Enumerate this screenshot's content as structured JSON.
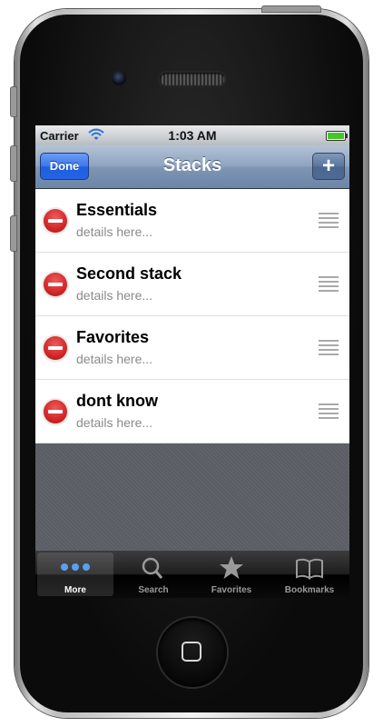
{
  "status_bar": {
    "carrier": "Carrier",
    "time": "1:03 AM"
  },
  "nav": {
    "title": "Stacks",
    "done_label": "Done",
    "add_label": "+"
  },
  "stacks": [
    {
      "title": "Essentials",
      "subtitle": "details here..."
    },
    {
      "title": "Second stack",
      "subtitle": "details here..."
    },
    {
      "title": "Favorites",
      "subtitle": "details here..."
    },
    {
      "title": "dont know",
      "subtitle": "details here..."
    }
  ],
  "tabs": [
    {
      "label": "More",
      "icon": "more-dots-icon",
      "selected": true
    },
    {
      "label": "Search",
      "icon": "magnifier-icon",
      "selected": false
    },
    {
      "label": "Favorites",
      "icon": "star-icon",
      "selected": false
    },
    {
      "label": "Bookmarks",
      "icon": "book-icon",
      "selected": false
    }
  ],
  "colors": {
    "nav_bar": "#8ea4bf",
    "done_button": "#3b77ee",
    "delete_icon": "#cc1f1f",
    "battery": "#47c62a",
    "tab_selected_dots": "#5aa0f0"
  }
}
